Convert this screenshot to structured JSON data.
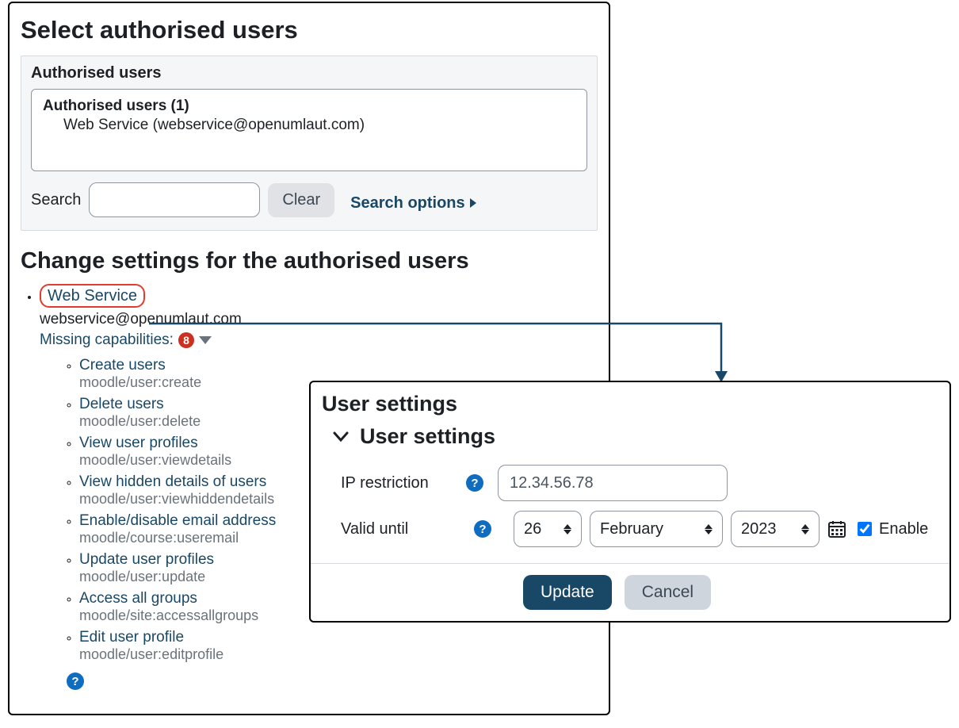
{
  "left": {
    "title": "Select authorised users",
    "greybox_title": "Authorised users",
    "userlist_header": "Authorised users (1)",
    "userlist_item": "Web Service (webservice@openumlaut.com)",
    "search_label": "Search",
    "clear_label": "Clear",
    "search_options": "Search options",
    "subtitle": "Change settings for the authorised users",
    "ws_link": "Web Service",
    "ws_email": "webservice@openumlaut.com",
    "missing_label": "Missing capabilities:",
    "missing_count": "8",
    "caps": [
      {
        "name": "Create users",
        "code": "moodle/user:create"
      },
      {
        "name": "Delete users",
        "code": "moodle/user:delete"
      },
      {
        "name": "View user profiles",
        "code": "moodle/user:viewdetails"
      },
      {
        "name": "View hidden details of users",
        "code": "moodle/user:viewhiddendetails"
      },
      {
        "name": "Enable/disable email address",
        "code": "moodle/course:useremail"
      },
      {
        "name": "Update user profiles",
        "code": "moodle/user:update"
      },
      {
        "name": "Access all groups",
        "code": "moodle/site:accessallgroups"
      },
      {
        "name": "Edit user profile",
        "code": "moodle/user:editprofile"
      }
    ]
  },
  "right": {
    "title": "User settings",
    "section_title": "User settings",
    "ip_label": "IP restriction",
    "ip_value": "12.34.56.78",
    "valid_label": "Valid until",
    "day": "26",
    "month": "February",
    "year": "2023",
    "enable_label": "Enable",
    "update_btn": "Update",
    "cancel_btn": "Cancel"
  }
}
